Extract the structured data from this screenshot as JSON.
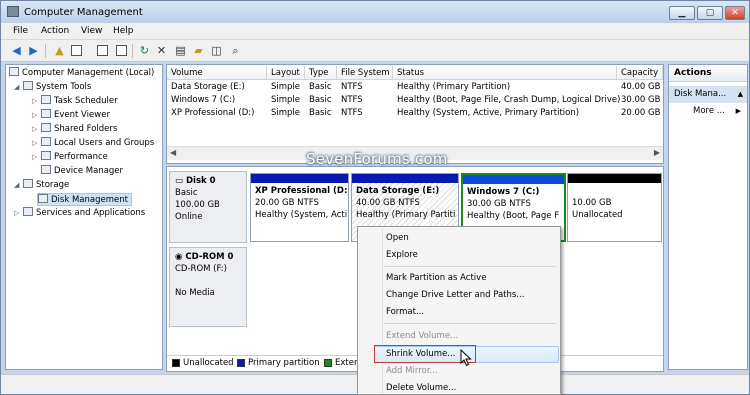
{
  "window": {
    "title": "Computer Management",
    "min": "▁",
    "max": "▢",
    "close": "✕"
  },
  "menu": [
    "File",
    "Action",
    "View",
    "Help"
  ],
  "toolbar_icons": [
    "back-icon",
    "forward-icon",
    "up-folder-icon",
    "show-hide-tree-icon",
    "properties-icon",
    "help-icon",
    "refresh-icon",
    "delete-icon",
    "properties-sheet-icon",
    "open-icon",
    "explore-icon",
    "search-icon"
  ],
  "tree": {
    "root": "Computer Management (Local)",
    "items": [
      {
        "label": "System Tools"
      },
      {
        "label": "Task Scheduler"
      },
      {
        "label": "Event Viewer"
      },
      {
        "label": "Shared Folders"
      },
      {
        "label": "Local Users and Groups"
      },
      {
        "label": "Performance"
      },
      {
        "label": "Device Manager"
      },
      {
        "label": "Storage"
      },
      {
        "label": "Disk Management"
      },
      {
        "label": "Services and Applications"
      }
    ]
  },
  "volumes": {
    "headers": [
      "Volume",
      "Layout",
      "Type",
      "File System",
      "Status",
      "Capacity"
    ],
    "rows": [
      [
        "Data Storage (E:)",
        "Simple",
        "Basic",
        "NTFS",
        "Healthy (Primary Partition)",
        "40.00 GB"
      ],
      [
        "Windows 7 (C:)",
        "Simple",
        "Basic",
        "NTFS",
        "Healthy (Boot, Page File, Crash Dump, Logical Drive)",
        "30.00 GB"
      ],
      [
        "XP Professional (D:)",
        "Simple",
        "Basic",
        "NTFS",
        "Healthy (System, Active, Primary Partition)",
        "20.00 GB"
      ]
    ]
  },
  "disks": {
    "disk0": {
      "name": "Disk 0",
      "type": "Basic",
      "size": "100.00 GB",
      "state": "Online"
    },
    "cdrom": {
      "name": "CD-ROM 0",
      "type": "CD-ROM (F:)",
      "state": "No Media"
    },
    "partitions": [
      {
        "title": "XP Professional  (D:)",
        "size": "20.00 GB NTFS",
        "status": "Healthy (System, Acti"
      },
      {
        "title": "Data Storage  (E:)",
        "size": "40.00 GB NTFS",
        "status": "Healthy (Primary Partiti"
      },
      {
        "title": "Windows 7  (C:)",
        "size": "30.00 GB NTFS",
        "status": "Healthy (Boot, Page F"
      },
      {
        "title": "",
        "size": "10.00 GB",
        "status": "Unallocated"
      }
    ]
  },
  "legend": {
    "unallocated": "Unallocated",
    "primary": "Primary partition",
    "extended": "Exten"
  },
  "actions": {
    "header": "Actions",
    "section": "Disk Mana...",
    "more": "More ..."
  },
  "watermark": "SevenForums.com",
  "context_menu": {
    "open": "Open",
    "explore": "Explore",
    "mark_active": "Mark Partition as Active",
    "change_letter": "Change Drive Letter and Paths...",
    "format": "Format...",
    "extend": "Extend Volume...",
    "shrink": "Shrink Volume...",
    "add_mirror": "Add Mirror...",
    "delete": "Delete Volume..."
  },
  "colors": {
    "primary": "#0a1ab0",
    "unallocated": "#000000",
    "extended": "#1a8a1a",
    "selection": "#cce4f7"
  }
}
